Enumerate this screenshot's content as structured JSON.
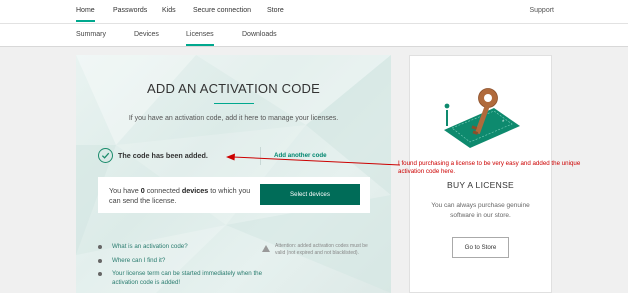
{
  "top_nav": {
    "items": [
      {
        "label": "Home",
        "active": true
      },
      {
        "label": "Passwords",
        "active": false
      },
      {
        "label": "Kids",
        "active": false
      },
      {
        "label": "Secure connection",
        "active": false
      },
      {
        "label": "Store",
        "active": false
      }
    ],
    "support": "Support"
  },
  "sub_nav": {
    "items": [
      {
        "label": "Summary",
        "active": false
      },
      {
        "label": "Devices",
        "active": false
      },
      {
        "label": "Licenses",
        "active": true
      },
      {
        "label": "Downloads",
        "active": false
      }
    ]
  },
  "activation": {
    "title": "ADD AN ACTIVATION CODE",
    "subtitle": "If you have an activation code, add it here to manage your licenses.",
    "success_message": "The code has been added.",
    "add_another_label": "Add another code",
    "devices": {
      "text_before": "You have ",
      "count": "0",
      "text_middle": " connected ",
      "devices_word": "devices",
      "text_after": " to which you can send the license.",
      "button_label": "Select devices"
    },
    "faq": [
      "What is an activation code?",
      "Where can I find it?",
      "Your license term can be started immediately when the activation code is added!"
    ],
    "warning": "Attention: added activation codes must be valid (not expired and not blacklisted)."
  },
  "buy_license": {
    "title": "BUY A LICENSE",
    "description": "You can always purchase genuine software in our store.",
    "button_label": "Go to Store"
  },
  "annotation": {
    "text": "I found purchasing a license to be very easy and added the unique activation code here."
  },
  "colors": {
    "accent": "#00a88e",
    "button_dark": "#006c58",
    "annotation_red": "#cc0000",
    "link": "#00866f"
  }
}
